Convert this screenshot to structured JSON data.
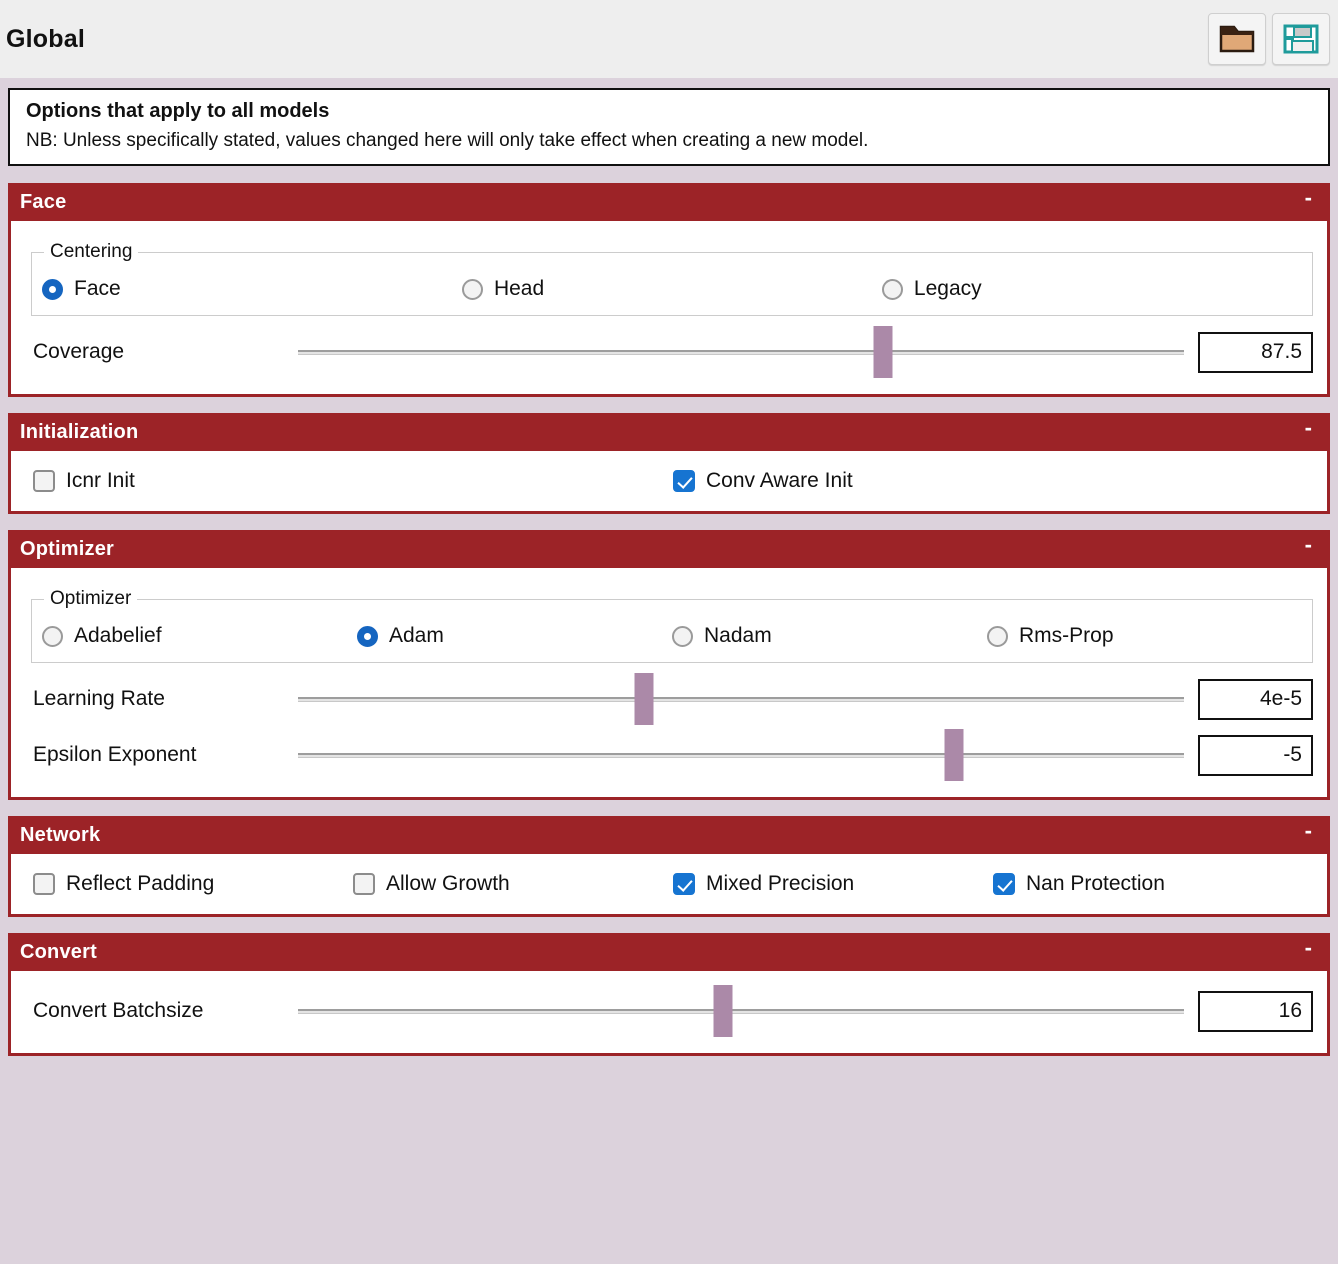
{
  "titlebar": {
    "title": "Global",
    "buttons": [
      {
        "name": "load-settings-button",
        "icon": "folder-icon"
      },
      {
        "name": "save-settings-button",
        "icon": "floppy-disk-icon"
      }
    ]
  },
  "infobox": {
    "heading": "Options that apply to all models",
    "note": "NB: Unless specifically stated, values changed here will only take effect when creating a new model."
  },
  "collapse_symbol": "-",
  "colors": {
    "section_header": "#9c2327",
    "page_background": "#dcd2dc",
    "titlebar_background": "#eeeeee",
    "accent_selected": "#1565c0",
    "slider_handle": "#ab89a8"
  },
  "sections": [
    {
      "title": "Face",
      "group": {
        "legend": "Centering",
        "options": [
          {
            "label": "Face",
            "selected": true
          },
          {
            "label": "Head",
            "selected": false
          },
          {
            "label": "Legacy",
            "selected": false
          }
        ]
      },
      "sliders": [
        {
          "label": "Coverage",
          "value": "87.5",
          "percent": 66
        }
      ]
    },
    {
      "title": "Initialization",
      "checkboxes": [
        {
          "label": "Icnr Init",
          "checked": false
        },
        {
          "label": "Conv Aware Init",
          "checked": true
        }
      ]
    },
    {
      "title": "Optimizer",
      "group": {
        "legend": "Optimizer",
        "options": [
          {
            "label": "Adabelief",
            "selected": false
          },
          {
            "label": "Adam",
            "selected": true
          },
          {
            "label": "Nadam",
            "selected": false
          },
          {
            "label": "Rms-Prop",
            "selected": false
          }
        ]
      },
      "sliders": [
        {
          "label": "Learning Rate",
          "value": "4e-5",
          "percent": 39
        },
        {
          "label": "Epsilon Exponent",
          "value": "-5",
          "percent": 74
        }
      ]
    },
    {
      "title": "Network",
      "checkboxes": [
        {
          "label": "Reflect Padding",
          "checked": false
        },
        {
          "label": "Allow Growth",
          "checked": false
        },
        {
          "label": "Mixed Precision",
          "checked": true
        },
        {
          "label": "Nan Protection",
          "checked": true
        }
      ]
    },
    {
      "title": "Convert",
      "sliders": [
        {
          "label": "Convert Batchsize",
          "value": "16",
          "percent": 48
        }
      ]
    }
  ]
}
